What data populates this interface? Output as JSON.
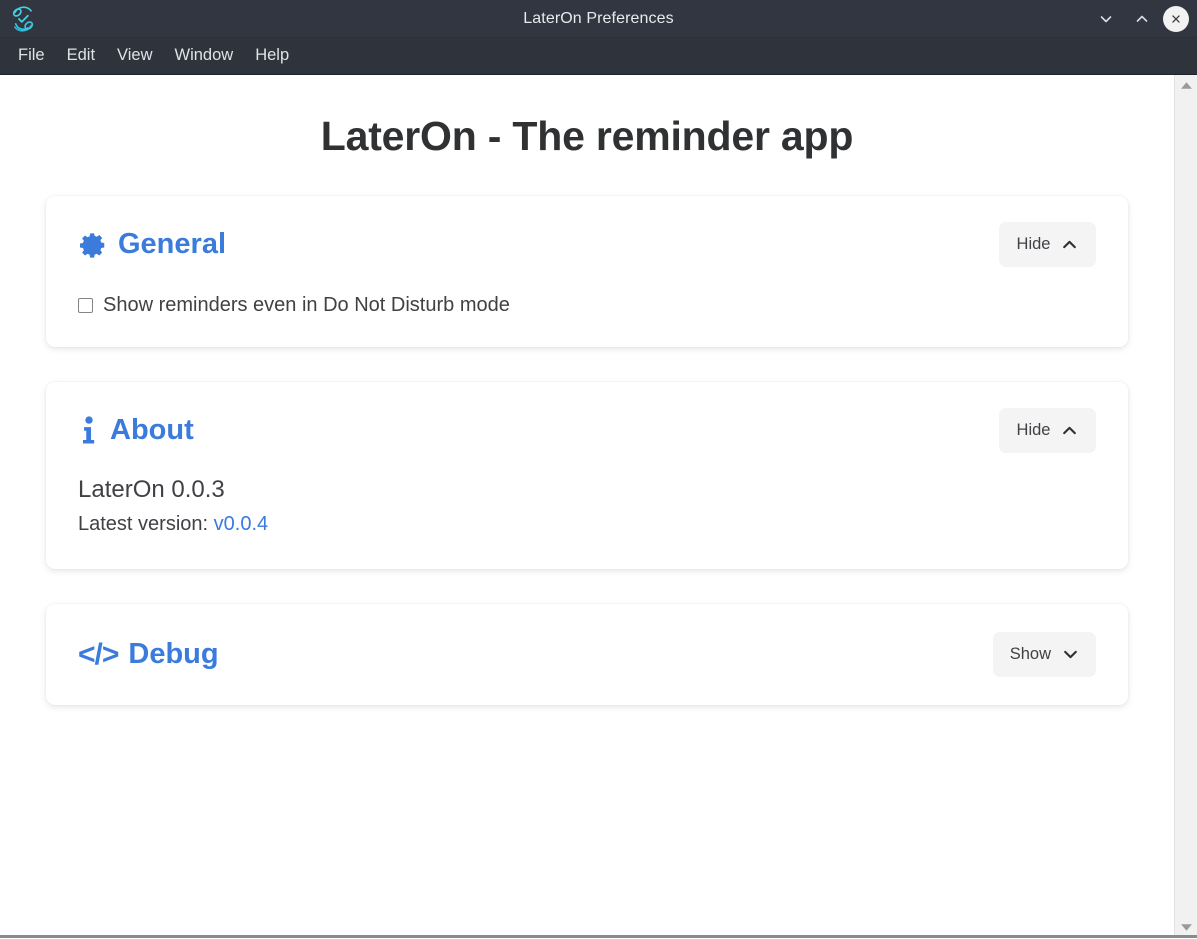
{
  "window": {
    "title": "LaterOn Preferences",
    "logo_icon": "lateron-logo-icon",
    "controls": [
      {
        "name": "minimize-button",
        "icon": "chevron-down-icon"
      },
      {
        "name": "maximize-button",
        "icon": "chevron-up-icon"
      },
      {
        "name": "close-button",
        "icon": "close-icon"
      }
    ]
  },
  "menubar": {
    "items": [
      {
        "label": "File"
      },
      {
        "label": "Edit"
      },
      {
        "label": "View"
      },
      {
        "label": "Window"
      },
      {
        "label": "Help"
      }
    ]
  },
  "page": {
    "title": "LaterOn - The reminder app"
  },
  "colors": {
    "accent": "#3a7bdc",
    "titlebar": "#313640",
    "menubar": "#2e333c",
    "button_bg": "#f4f4f5",
    "text": "#3f4145",
    "heading": "#2f3133"
  },
  "sections": {
    "general": {
      "title": "General",
      "icon": "gear-icon",
      "toggle": {
        "label": "Hide",
        "icon": "chevron-up-icon"
      },
      "checkbox": {
        "label": "Show reminders even in Do Not Disturb mode",
        "checked": false
      }
    },
    "about": {
      "title": "About",
      "icon": "info-icon",
      "toggle": {
        "label": "Hide",
        "icon": "chevron-up-icon"
      },
      "version": "LaterOn 0.0.3",
      "latest_label": "Latest version:",
      "latest_link": "v0.0.4"
    },
    "debug": {
      "title": "Debug",
      "icon": "code-icon",
      "icon_glyph": "</>",
      "toggle": {
        "label": "Show",
        "icon": "chevron-down-icon"
      }
    }
  },
  "scrollbar": {
    "up_icon": "scroll-up-arrow-icon",
    "down_icon": "scroll-down-arrow-icon"
  }
}
